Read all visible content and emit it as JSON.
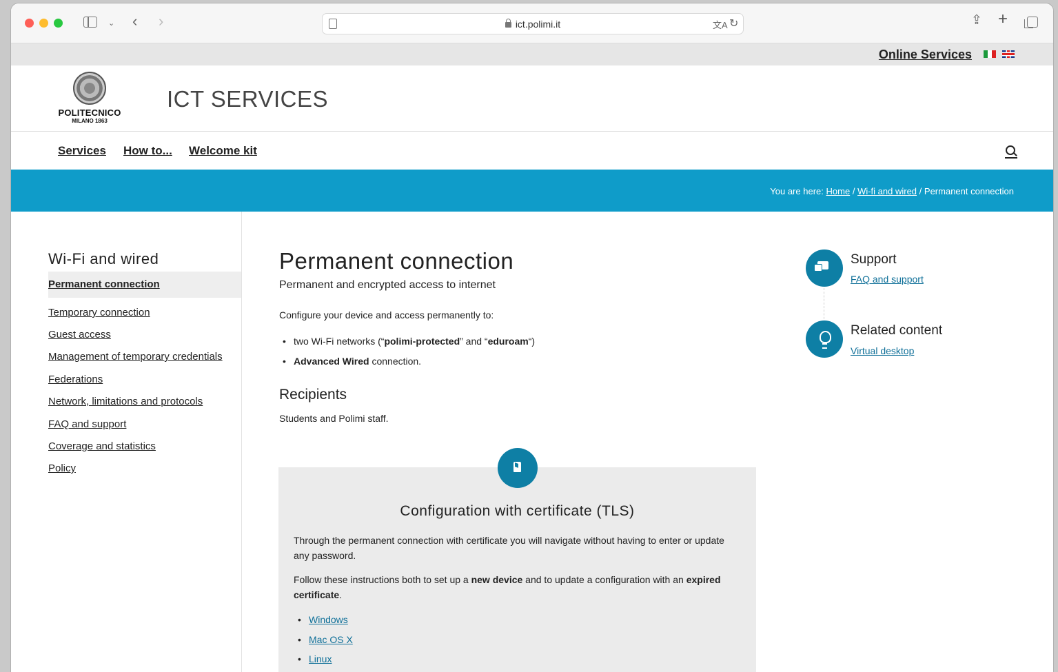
{
  "browser": {
    "url": "ict.polimi.it"
  },
  "topbar": {
    "online_services": "Online Services"
  },
  "header": {
    "logo_name": "POLITECNICO",
    "logo_sub": "MILANO 1863",
    "site_title": "ICT SERVICES"
  },
  "nav": {
    "items": [
      "Services",
      "How to...",
      "Welcome kit"
    ]
  },
  "breadcrumb": {
    "prefix": "You are here:",
    "home": "Home",
    "sep": "/",
    "parent": "Wi-fi and wired",
    "current": "Permanent connection"
  },
  "sidebar": {
    "title": "Wi-Fi and wired",
    "active": "Permanent connection",
    "items": [
      "Temporary connection",
      "Guest access",
      "Management of temporary credentials",
      "Federations",
      "Network, limitations and protocols",
      "FAQ and support",
      "Coverage and statistics",
      "Policy"
    ]
  },
  "main": {
    "title": "Permanent connection",
    "subtitle": "Permanent and encrypted access to internet",
    "intro": "Configure your device and access permanently to:",
    "bullet1_pre": "two Wi-Fi networks (“",
    "bullet1_b1": "polimi-protected",
    "bullet1_mid": "” and “",
    "bullet1_b2": "eduroam",
    "bullet1_post": "“)",
    "bullet2_b": "Advanced Wired",
    "bullet2_post": " connection.",
    "recipients_title": "Recipients",
    "recipients_text": "Students and Polimi staff."
  },
  "config_box": {
    "title": "Configuration with certificate (TLS)",
    "para1": "Through the permanent connection with certificate you will navigate without having to enter or update any password.",
    "para2_pre": "Follow these instructions both to set up a ",
    "para2_b1": "new device",
    "para2_mid": " and to update a configuration with an ",
    "para2_b2": "expired certificate",
    "para2_post": ".",
    "links": [
      "Windows",
      "Mac OS X",
      "Linux"
    ]
  },
  "aside": {
    "support_title": "Support",
    "support_link": "FAQ and support",
    "related_title": "Related content",
    "related_link": "Virtual desktop"
  },
  "colors": {
    "accent": "#0f9cc9",
    "icon_circle": "#0e7fa5",
    "link": "#0e6f98"
  }
}
